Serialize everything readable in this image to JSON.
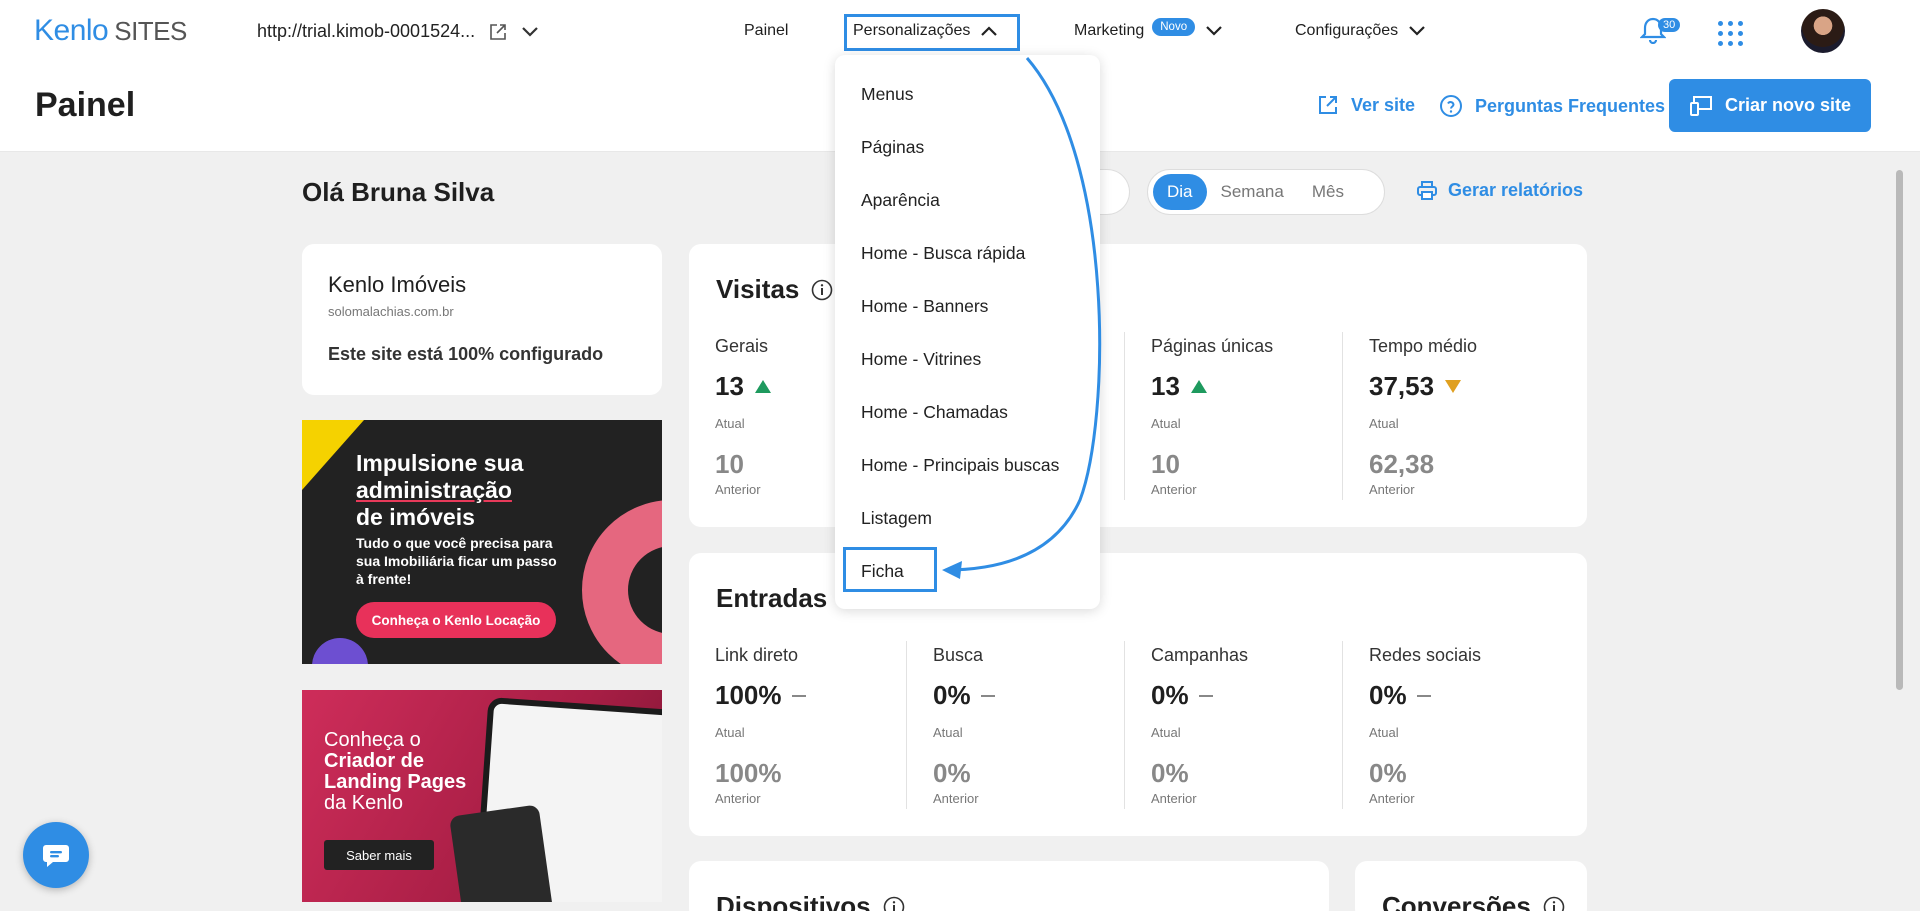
{
  "header": {
    "logo_main": "Kenlo",
    "logo_sub": "SITES",
    "site_url": "http://trial.kimob-0001524...",
    "nav": {
      "painel": "Painel",
      "personalizacoes": "Personalizações",
      "marketing": "Marketing",
      "marketing_badge": "Novo",
      "configuracoes": "Configurações"
    },
    "notifications_count": "30"
  },
  "subheader": {
    "title": "Painel",
    "ver_site": "Ver site",
    "faq": "Perguntas Frequentes",
    "create_button": "Criar novo site"
  },
  "greeting": "Olá Bruna Silva",
  "period": {
    "day": "Dia",
    "week": "Semana",
    "month": "Mês",
    "selected": "Dia"
  },
  "report_link": "Gerar relatórios",
  "site_card": {
    "name": "Kenlo Imóveis",
    "url": "solomalachias.com.br",
    "status": "Este site está 100% configurado"
  },
  "promo1": {
    "line1": "Impulsione sua",
    "line2": "administração",
    "line3": "de imóveis",
    "text": "Tudo o que você precisa para sua Imobiliária ficar um passo à frente!",
    "button": "Conheça o Kenlo Locação"
  },
  "promo2": {
    "line1": "Conheça o",
    "line2": "Criador de",
    "line3": "Landing Pages",
    "line4": "da Kenlo",
    "button": "Saber mais"
  },
  "visitas": {
    "title": "Visitas",
    "items": [
      {
        "label": "Gerais",
        "current": "13",
        "current_label": "Atual",
        "previous": "10",
        "previous_label": "Anterior",
        "trend": "up"
      },
      {
        "label": "Páginas únicas",
        "current": "13",
        "current_label": "Atual",
        "previous": "10",
        "previous_label": "Anterior",
        "trend": "up"
      },
      {
        "label": "Tempo médio",
        "current": "37,53",
        "current_label": "Atual",
        "previous": "62,38",
        "previous_label": "Anterior",
        "trend": "down"
      }
    ]
  },
  "entradas": {
    "title": "Entradas",
    "items": [
      {
        "label": "Link direto",
        "current": "100%",
        "current_label": "Atual",
        "previous": "100%",
        "previous_label": "Anterior"
      },
      {
        "label": "Busca",
        "current": "0%",
        "current_label": "Atual",
        "previous": "0%",
        "previous_label": "Anterior"
      },
      {
        "label": "Campanhas",
        "current": "0%",
        "current_label": "Atual",
        "previous": "0%",
        "previous_label": "Anterior"
      },
      {
        "label": "Redes sociais",
        "current": "0%",
        "current_label": "Atual",
        "previous": "0%",
        "previous_label": "Anterior"
      }
    ]
  },
  "bottom": {
    "dispositivos": "Dispositivos",
    "conversoes": "Conversões"
  },
  "menu": {
    "items": [
      "Menus",
      "Páginas",
      "Aparência",
      "Home - Busca rápida",
      "Home - Banners",
      "Home - Vitrines",
      "Home - Chamadas",
      "Home - Principais buscas",
      "Listagem",
      "Ficha"
    ],
    "highlighted": "Ficha"
  },
  "colors": {
    "accent": "#2f8de4",
    "up": "#1e9a5e",
    "down": "#e0a020"
  }
}
